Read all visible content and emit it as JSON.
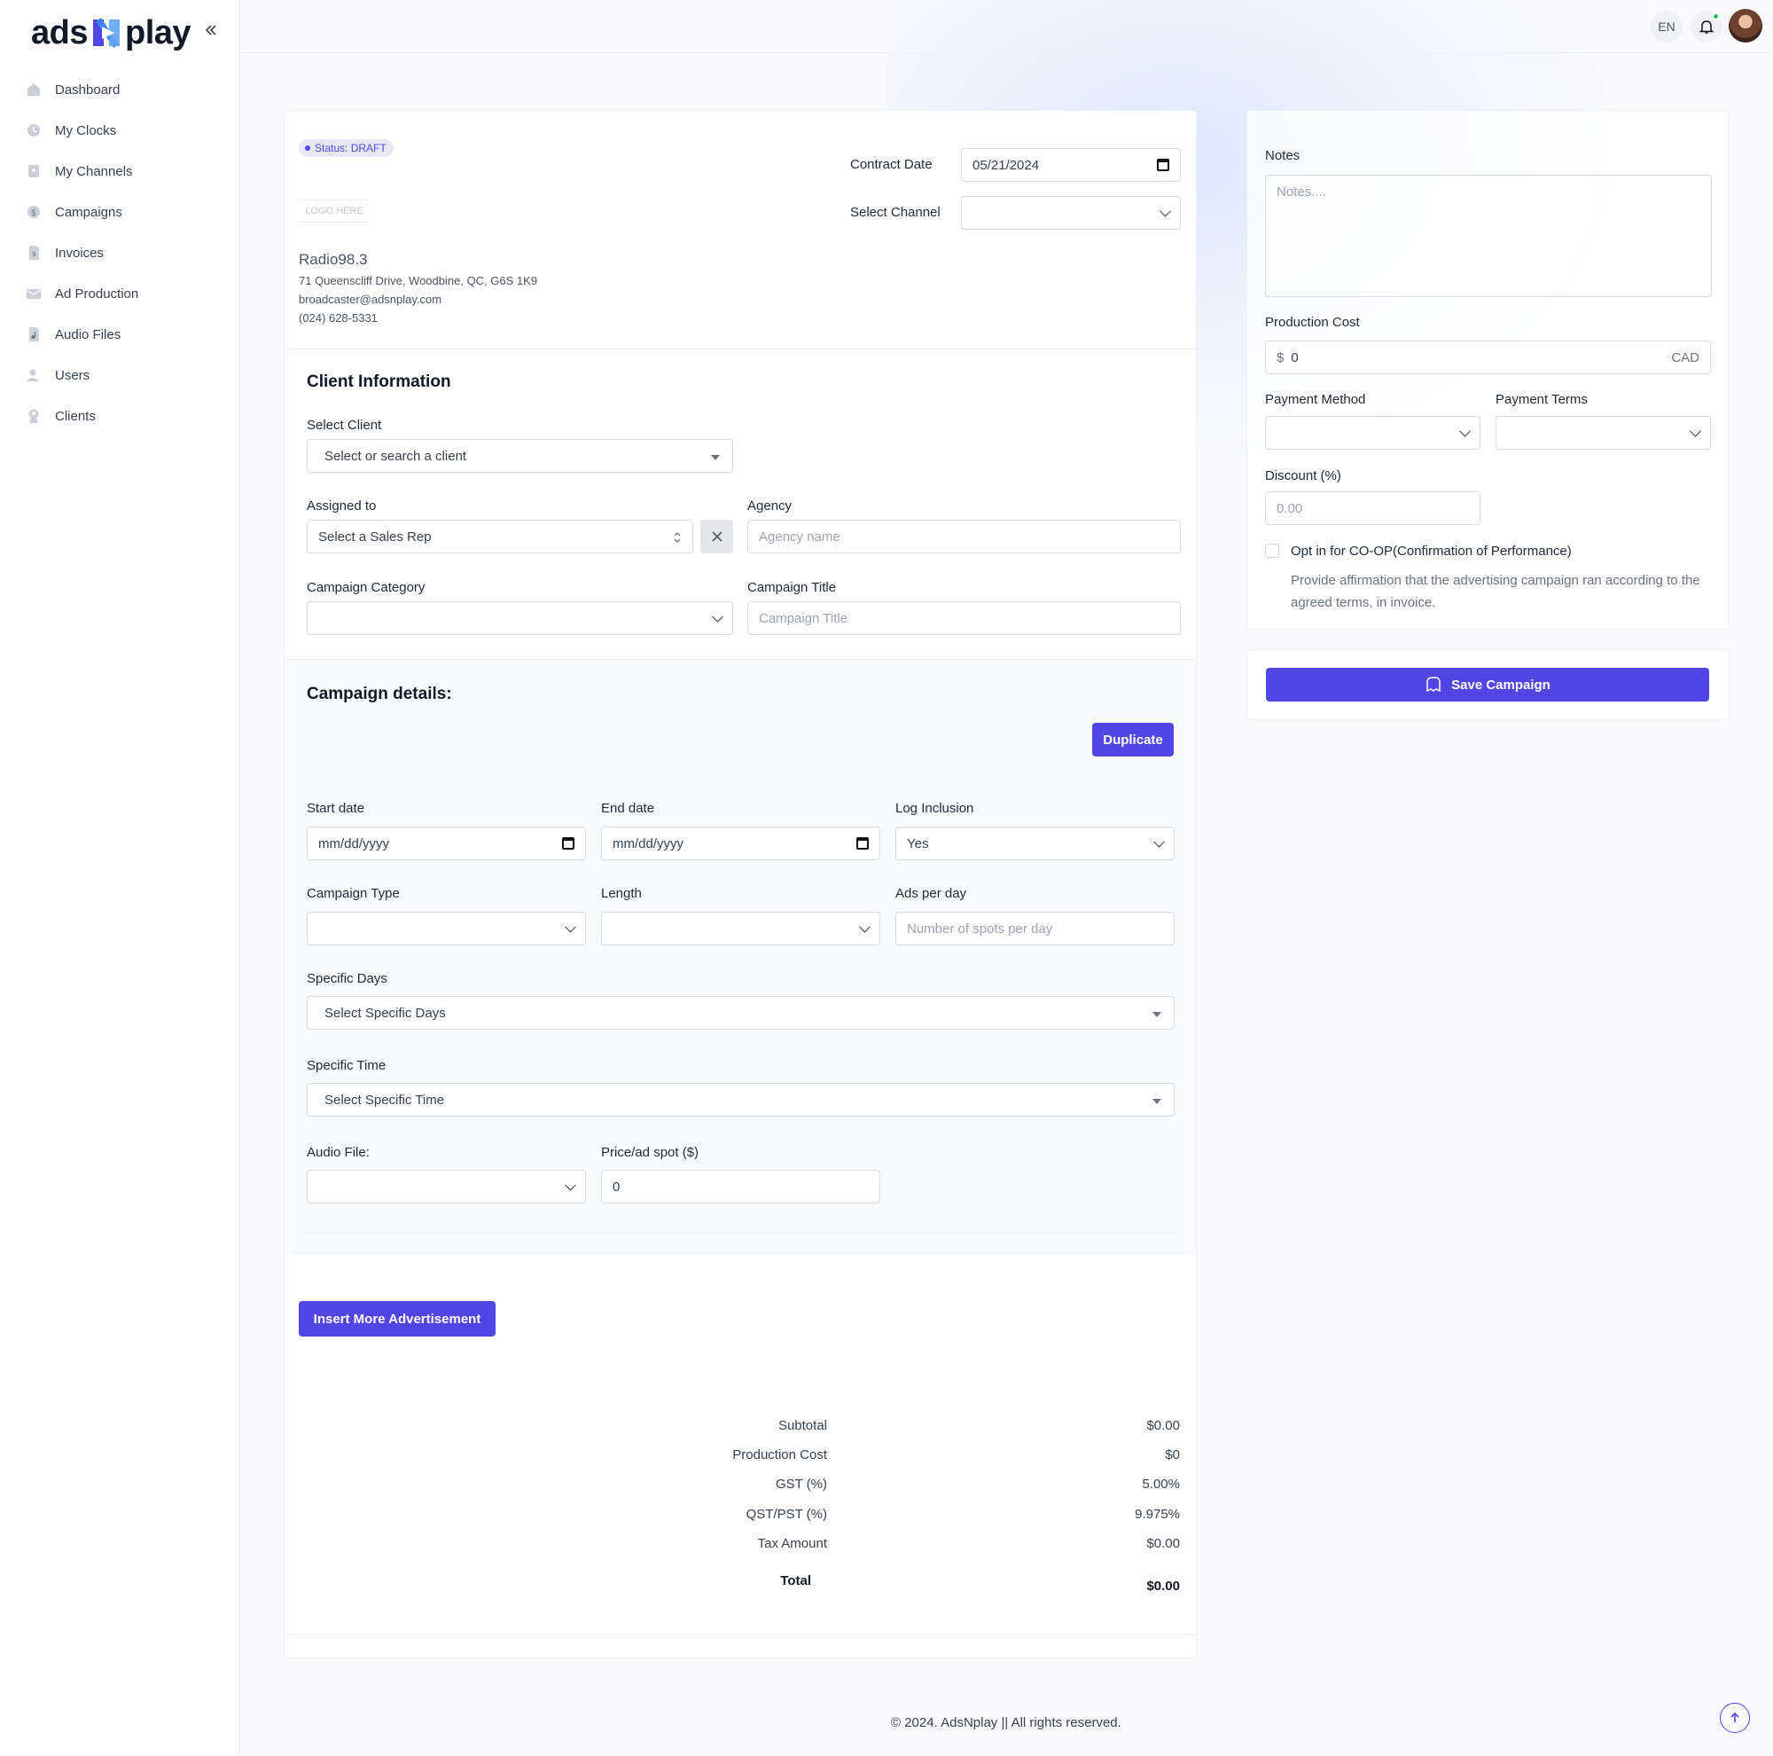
{
  "brand": {
    "logo_left": "ads",
    "logo_right": "play"
  },
  "sidebar": {
    "items": [
      {
        "label": "Dashboard",
        "icon": "home-icon"
      },
      {
        "label": "My Clocks",
        "icon": "clock-icon"
      },
      {
        "label": "My Channels",
        "icon": "channel-icon"
      },
      {
        "label": "Campaigns",
        "icon": "dollar-icon"
      },
      {
        "label": "Invoices",
        "icon": "invoice-icon"
      },
      {
        "label": "Ad Production",
        "icon": "mail-icon"
      },
      {
        "label": "Audio Files",
        "icon": "audio-file-icon"
      },
      {
        "label": "Users",
        "icon": "users-icon"
      },
      {
        "label": "Clients",
        "icon": "client-icon"
      }
    ]
  },
  "topbar": {
    "language": "EN"
  },
  "header": {
    "status": "Status: DRAFT",
    "logo_placeholder": "LOGO HERE",
    "org_name": "Radio98.3",
    "org_address": "71 Queenscliff Drive, Woodbine, QC, G6S 1K9",
    "org_email": "broadcaster@adsnplay.com",
    "org_phone": "(024) 628-5331",
    "contract_date_label": "Contract Date",
    "contract_date_value": "05/21/2024",
    "select_channel_label": "Select Channel",
    "select_channel_value": ""
  },
  "client_info": {
    "title": "Client Information",
    "select_client_label": "Select Client",
    "select_client_placeholder": "Select or search a client",
    "assigned_to_label": "Assigned to",
    "assigned_to_placeholder": "Select a Sales Rep",
    "agency_label": "Agency",
    "agency_placeholder": "Agency name",
    "campaign_category_label": "Campaign Category",
    "campaign_title_label": "Campaign Title",
    "campaign_title_placeholder": "Campaign Title"
  },
  "campaign_details": {
    "title": "Campaign details:",
    "duplicate_label": "Duplicate",
    "start_date_label": "Start date",
    "start_date_placeholder": "mm/dd/yyyy",
    "end_date_label": "End date",
    "end_date_placeholder": "mm/dd/yyyy",
    "log_inclusion_label": "Log Inclusion",
    "log_inclusion_value": "Yes",
    "campaign_type_label": "Campaign Type",
    "length_label": "Length",
    "ads_per_day_label": "Ads per day",
    "ads_per_day_placeholder": "Number of spots per day",
    "specific_days_label": "Specific Days",
    "specific_days_placeholder": "Select Specific Days",
    "specific_time_label": "Specific Time",
    "specific_time_placeholder": "Select Specific Time",
    "audio_file_label": "Audio File:",
    "price_label": "Price/ad spot ($)",
    "price_value": "0",
    "insert_more_label": "Insert More Advertisement"
  },
  "summary": {
    "subtotal_label": "Subtotal",
    "subtotal_value": "$0.00",
    "production_cost_label": "Production Cost",
    "production_cost_value": "$0",
    "gst_label": "GST (%)",
    "gst_value": "5.00%",
    "qst_label": "QST/PST (%)",
    "qst_value": "9.975%",
    "tax_label": "Tax Amount",
    "tax_value": "$0.00",
    "total_label": "Total",
    "total_value": "$0.00"
  },
  "side": {
    "notes_label": "Notes",
    "notes_placeholder": "Notes....",
    "production_cost_label": "Production Cost",
    "production_cost_prefix": "$",
    "production_cost_value": "0",
    "production_cost_suffix": "CAD",
    "payment_method_label": "Payment Method",
    "payment_terms_label": "Payment Terms",
    "discount_label": "Discount (%)",
    "discount_placeholder": "0.00",
    "coop_label": "Opt in for CO-OP(Confirmation of Performance)",
    "coop_help": "Provide affirmation that the advertising campaign ran according to the agreed terms, in invoice.",
    "save_label": "Save Campaign"
  },
  "footer": {
    "text": "© 2024. AdsNplay || All rights reserved."
  },
  "colors": {
    "primary": "#4f46e5",
    "status_dot": "#22c55e"
  }
}
